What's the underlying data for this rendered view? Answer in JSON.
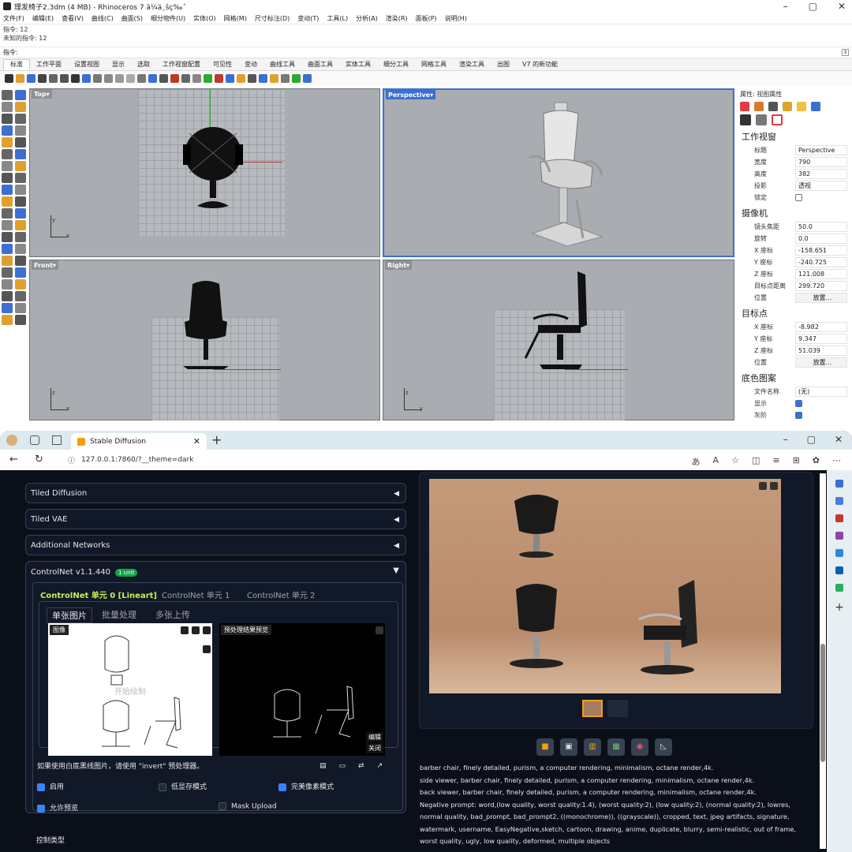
{
  "rhino": {
    "title": "理发椅子2.3dm (4 MB) - Rhinoceros 7 â¼ä¸šç‰ˆ",
    "menu": [
      "文件(F)",
      "编辑(E)",
      "查看(V)",
      "曲线(C)",
      "曲面(S)",
      "细分物件(U)",
      "实体(O)",
      "网格(M)",
      "尺寸标注(D)",
      "变动(T)",
      "工具(L)",
      "分析(A)",
      "渲染(R)",
      "面板(P)",
      "说明(H)"
    ],
    "history": [
      "指令: 12",
      "未知的指令: 12"
    ],
    "command_prompt": "指令:",
    "tabs": [
      "标准",
      "工作平面",
      "设置视图",
      "显示",
      "选取",
      "工作视窗配置",
      "可见性",
      "变动",
      "曲线工具",
      "曲面工具",
      "实体工具",
      "细分工具",
      "网格工具",
      "渲染工具",
      "出图",
      "V7 的新功能"
    ],
    "viewports": {
      "top": "Top",
      "perspective": "Perspective",
      "front": "Front",
      "right": "Right"
    },
    "axes": {
      "top": [
        "y",
        "x"
      ],
      "front": [
        "z",
        "x"
      ],
      "right": [
        "z",
        "y"
      ]
    },
    "props": {
      "header": "属性: 视图属性",
      "sec_viewport": "工作视窗",
      "viewport_rows": [
        [
          "标题",
          "Perspective"
        ],
        [
          "宽度",
          "790"
        ],
        [
          "高度",
          "382"
        ],
        [
          "投影",
          "透视"
        ]
      ],
      "lock_label": "锁定",
      "sec_camera": "摄像机",
      "camera_rows": [
        [
          "镜头焦距",
          "50.0"
        ],
        [
          "旋转",
          "0.0"
        ],
        [
          "X 座标",
          "-158.651"
        ],
        [
          "Y 座标",
          "-240.725"
        ],
        [
          "Z 座标",
          "121.008"
        ],
        [
          "目标点距离",
          "299.720"
        ]
      ],
      "place_label": "位置",
      "place_btn": "放置...",
      "sec_target": "目标点",
      "target_rows": [
        [
          "X 座标",
          "-8.982"
        ],
        [
          "Y 座标",
          "9.347"
        ],
        [
          "Z 座标",
          "51.039"
        ]
      ],
      "sec_wallpaper": "底色图案",
      "wallpaper_file_label": "文件名称",
      "wallpaper_file": "(无)",
      "show_label": "显示",
      "gray_label": "灰阶"
    }
  },
  "browser": {
    "tab_title": "Stable Diffusion",
    "url": "127.0.0.1:7860/?__theme=dark",
    "accordions": [
      "Tiled Diffusion",
      "Tiled VAE",
      "Additional Networks"
    ],
    "controlnet": {
      "title": "ControlNet v1.1.440",
      "badge": "1 unit",
      "units": [
        "ControlNet 单元 0 [Lineart]",
        "ControlNet 单元 1",
        "ControlNet 单元 2"
      ],
      "modes": [
        "单张图片",
        "批量处理",
        "多张上传"
      ],
      "image_label": "图像",
      "preview_label": "预处理结果预览",
      "canvas_hint": "开始绘制",
      "edit_btn": "编辑",
      "close_btn": "关闭",
      "invert_hint": "如果使用白底黑线图片，请使用 \"invert\" 预处理器。",
      "enable": "启用",
      "lowvram": "低显存模式",
      "pixel_perfect": "完美像素模式",
      "allow_preview": "允许预览",
      "mask_upload": "Mask Upload",
      "control_type": "控制类型"
    },
    "prompt_lines": [
      "barber chair, finely detailed, purism, a computer rendering, minimalism, octane render,4k.",
      "side viewer, barber chair, finely detailed, purism, a computer rendering, minimalism, octane render,4k.",
      "back viewer, barber chair, finely detailed, purism, a computer rendering, minimalism, octane render,4k.",
      "Negative prompt: word,(low quality, worst quality:1.4), (worst quality:2), (low quality:2), (normal quality:2), lowres,",
      "normal quality, bad_prompt, bad_prompt2, ((monochrome)), ((grayscale)), cropped, text, jpeg artifacts, signature,",
      "watermark, username, EasyNegative,sketch, cartoon, drawing, anime, duplicate, blurry, semi-realistic, out of frame,",
      "worst quality, ugly, low quality, deformed, multiple objects"
    ]
  }
}
